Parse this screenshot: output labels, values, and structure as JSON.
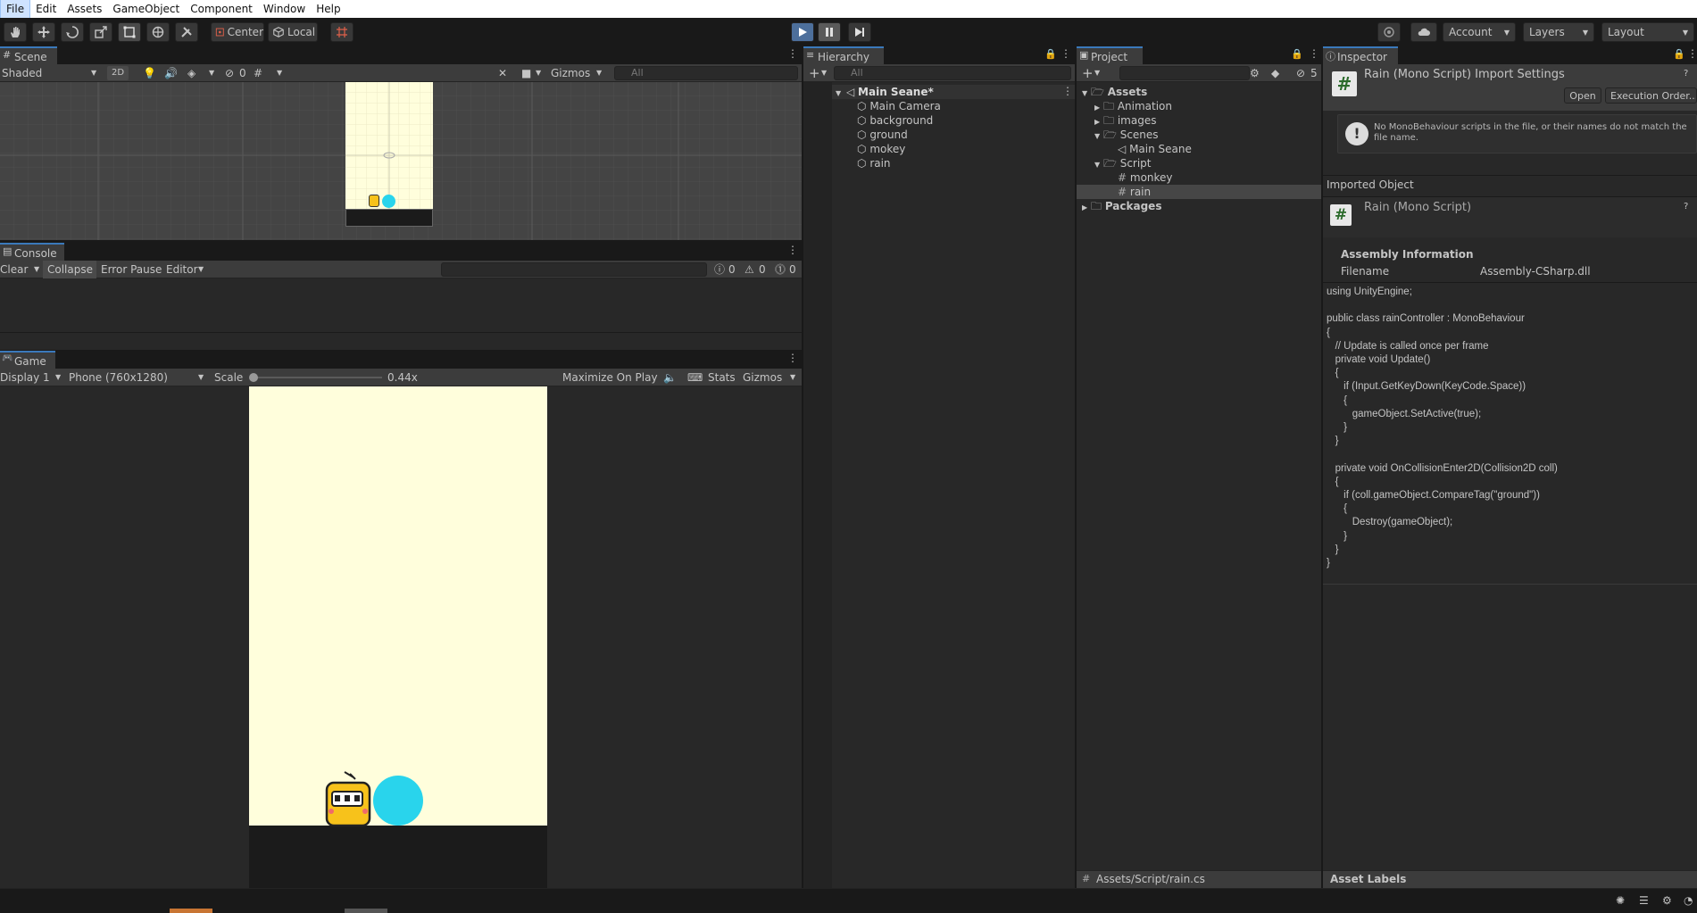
{
  "menu": [
    "File",
    "Edit",
    "Assets",
    "GameObject",
    "Component",
    "Window",
    "Help"
  ],
  "toolbar": {
    "pivot": "Center",
    "space": "Local",
    "account": "Account",
    "layers": "Layers",
    "layout": "Layout"
  },
  "scene": {
    "tab": "Scene",
    "shading": "Shaded",
    "mode_2d": "2D",
    "hidden_count": "0",
    "gizmos": "Gizmos",
    "search_placeholder": "All"
  },
  "console": {
    "tab": "Console",
    "clear": "Clear",
    "collapse": "Collapse",
    "error_pause": "Error Pause",
    "editor": "Editor",
    "log_count": "0",
    "warn_count": "0",
    "error_count": "0"
  },
  "game": {
    "tab": "Game",
    "display": "Display 1",
    "resolution": "Phone (760x1280)",
    "scale_label": "Scale",
    "scale_value": "0.44x",
    "maximize": "Maximize On Play",
    "stats": "Stats",
    "gizmos": "Gizmos"
  },
  "hierarchy": {
    "tab": "Hierarchy",
    "search_placeholder": "All",
    "scene_name": "Main Seane*",
    "items": [
      "Main Camera",
      "background",
      "ground",
      "mokey",
      "rain"
    ]
  },
  "project": {
    "tab": "Project",
    "hidden_count": "5",
    "tree": {
      "assets": "Assets",
      "animation": "Animation",
      "images": "images",
      "scenes": "Scenes",
      "main_scene": "Main Seane",
      "script": "Script",
      "monkey": "monkey",
      "rain": "rain",
      "packages": "Packages"
    },
    "path": "Assets/Script/rain.cs"
  },
  "inspector": {
    "tab": "Inspector",
    "title": "Rain (Mono Script) Import Settings",
    "open": "Open",
    "execution_order": "Execution Order...",
    "warning": "No MonoBehaviour scripts in the file, or their names do not match the file name.",
    "imported_object": "Imported Object",
    "object_name": "Rain (Mono Script)",
    "assembly_info": "Assembly Information",
    "filename_label": "Filename",
    "filename_value": "Assembly-CSharp.dll",
    "code": "using UnityEngine;\n\npublic class rainController : MonoBehaviour\n{\n   // Update is called once per frame\n   private void Update()\n   {\n      if (Input.GetKeyDown(KeyCode.Space))\n      {\n         gameObject.SetActive(true);\n      }\n   }\n\n   private void OnCollisionEnter2D(Collision2D coll)\n   {\n      if (coll.gameObject.CompareTag(\"ground\"))\n      {\n         Destroy(gameObject);\n      }\n   }\n}",
    "asset_labels": "Asset Labels"
  },
  "colors": {
    "accent": "#3a79bb",
    "panel": "#282828",
    "game_bg": "#fffedc",
    "ground": "#1b1b1b",
    "ball": "#29d4ec",
    "monkey": "#f7c21b"
  }
}
